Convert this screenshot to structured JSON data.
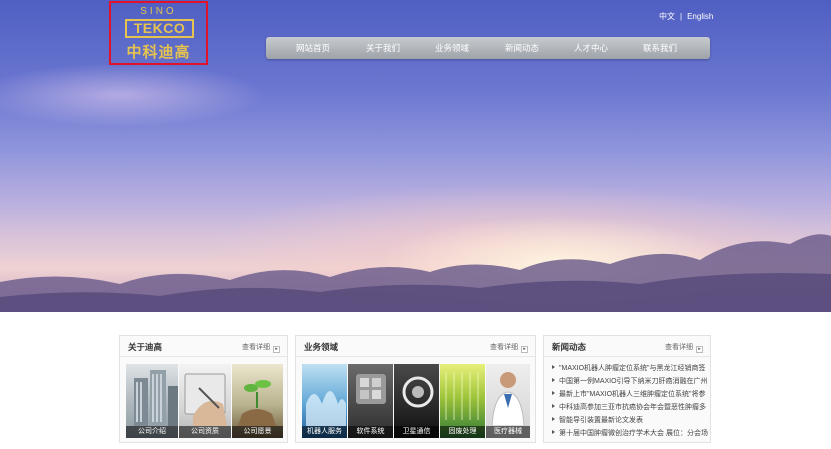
{
  "header": {
    "logo": {
      "top_text": "SINO",
      "brand_text": "TEKCO",
      "cn_text": "中科迪高"
    },
    "language": {
      "chinese": "中文",
      "separator": "|",
      "english": "English"
    },
    "nav": [
      "网站首页",
      "关于我们",
      "业务领域",
      "新闻动态",
      "人才中心",
      "联系我们"
    ]
  },
  "panels": {
    "about": {
      "title": "关于迪高",
      "more": "查看详细",
      "items": [
        "公司介绍",
        "公司资质",
        "公司愿景"
      ]
    },
    "business": {
      "title": "业务领域",
      "more": "查看详细",
      "items": [
        "机器人服务",
        "软件系统",
        "卫星通信",
        "固废处理",
        "医疗器械"
      ]
    },
    "news": {
      "title": "新闻动态",
      "more": "查看详细",
      "items": [
        "\"MAXIO机器人肿瘤定位系统\"与黑龙江经销商签",
        "中国第一例MAXIO引导下纳米刀肝癌消融在广州",
        "最新上市\"MAXIO机器人三维肿瘤定位系统\"将参",
        "中科迪高参加三亚市抗癌协会年会暨恶性肿瘤多",
        "智能导引装置最新论文发表",
        "第十届中国肿瘤微创治疗学术大会 展位：分会场"
      ]
    }
  },
  "colors": {
    "logo_gold": "#e6c34e",
    "highlight_border": "#e0132a",
    "nav_bg": "#a9adb3"
  }
}
